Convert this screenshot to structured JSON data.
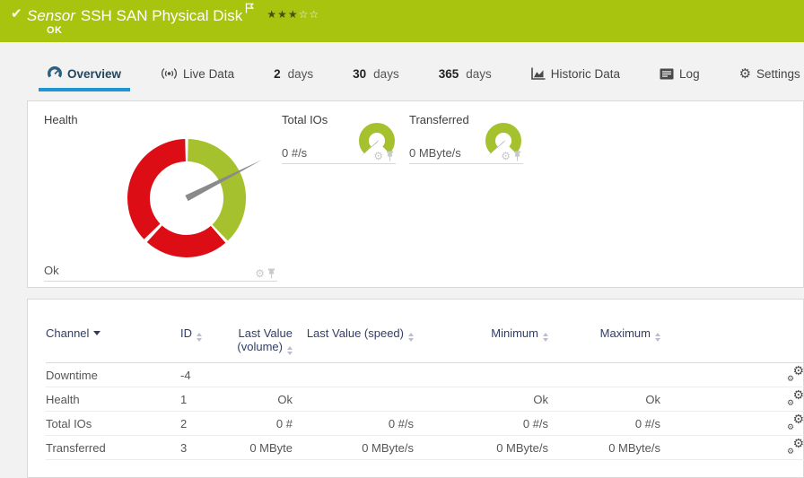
{
  "header": {
    "check_glyph": "✔",
    "type_label": "Sensor",
    "title": "SSH SAN Physical Disk",
    "status": "OK",
    "stars_filled": "★★★",
    "stars_empty": "☆☆"
  },
  "tabs": {
    "overview": "Overview",
    "live_data": "Live Data",
    "days2_num": "2",
    "days2_unit": "days",
    "days30_num": "30",
    "days30_unit": "days",
    "days365_num": "365",
    "days365_unit": "days",
    "historic_data": "Historic Data",
    "log": "Log",
    "settings": "Settings"
  },
  "gauges": {
    "health": {
      "label": "Health",
      "value": "Ok"
    },
    "total_ios": {
      "label": "Total IOs",
      "value": "0 #/s"
    },
    "transferred": {
      "label": "Transferred",
      "value": "0 MByte/s"
    }
  },
  "table": {
    "headers": {
      "channel": "Channel",
      "id": "ID",
      "volume": "Last Value (volume)",
      "speed": "Last Value (speed)",
      "minimum": "Minimum",
      "maximum": "Maximum"
    },
    "rows": [
      {
        "channel": "Downtime",
        "id": "-4",
        "volume": "",
        "speed": "",
        "minimum": "",
        "maximum": ""
      },
      {
        "channel": "Health",
        "id": "1",
        "volume": "Ok",
        "speed": "",
        "minimum": "Ok",
        "maximum": "Ok"
      },
      {
        "channel": "Total IOs",
        "id": "2",
        "volume": "0 #",
        "speed": "0 #/s",
        "minimum": "0 #/s",
        "maximum": "0 #/s"
      },
      {
        "channel": "Transferred",
        "id": "3",
        "volume": "0 MByte",
        "speed": "0 MByte/s",
        "minimum": "0 MByte/s",
        "maximum": "0 MByte/s"
      }
    ]
  },
  "colors": {
    "header_green": "#a9c40e",
    "gauge_green": "#a5c12d",
    "gauge_red": "#dc0d15",
    "accent_blue": "#1e96d2",
    "needle_gray": "#8a8a8a"
  }
}
